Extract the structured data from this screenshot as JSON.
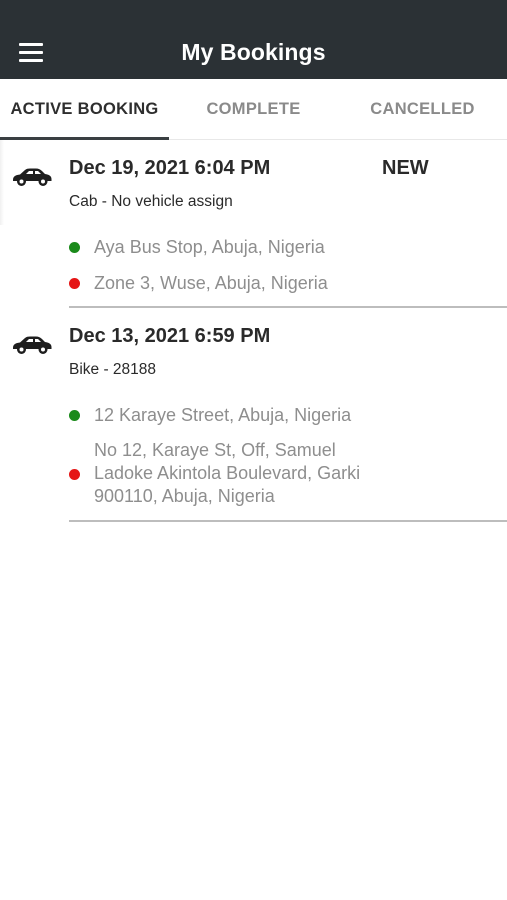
{
  "header": {
    "title": "My Bookings",
    "background": "#2b3135"
  },
  "tabs": [
    {
      "label": "ACTIVE BOOKING",
      "active": true
    },
    {
      "label": "COMPLETE",
      "active": false
    },
    {
      "label": "CANCELLED",
      "active": false
    }
  ],
  "bookings": [
    {
      "icon": "car-icon",
      "date": "Dec 19, 2021 6:04 PM",
      "status": "NEW",
      "vehicle": "Cab - No vehicle assign",
      "pickup": "Aya Bus Stop, Abuja, Nigeria",
      "dropoff": "Zone 3, Wuse, Abuja, Nigeria"
    },
    {
      "icon": "car-icon",
      "date": "Dec 13, 2021 6:59 PM",
      "status": "",
      "vehicle": "Bike - 28188",
      "pickup": "12 Karaye Street, Abuja, Nigeria",
      "dropoff": "No 12, Karaye St, Off, Samuel Ladoke Akintola Boulevard, Garki 900110, Abuja, Nigeria"
    }
  ],
  "colors": {
    "pickup_dot": "#1a8a1a",
    "dropoff_dot": "#e51515",
    "active_tab_indicator": "#3a3f42"
  }
}
